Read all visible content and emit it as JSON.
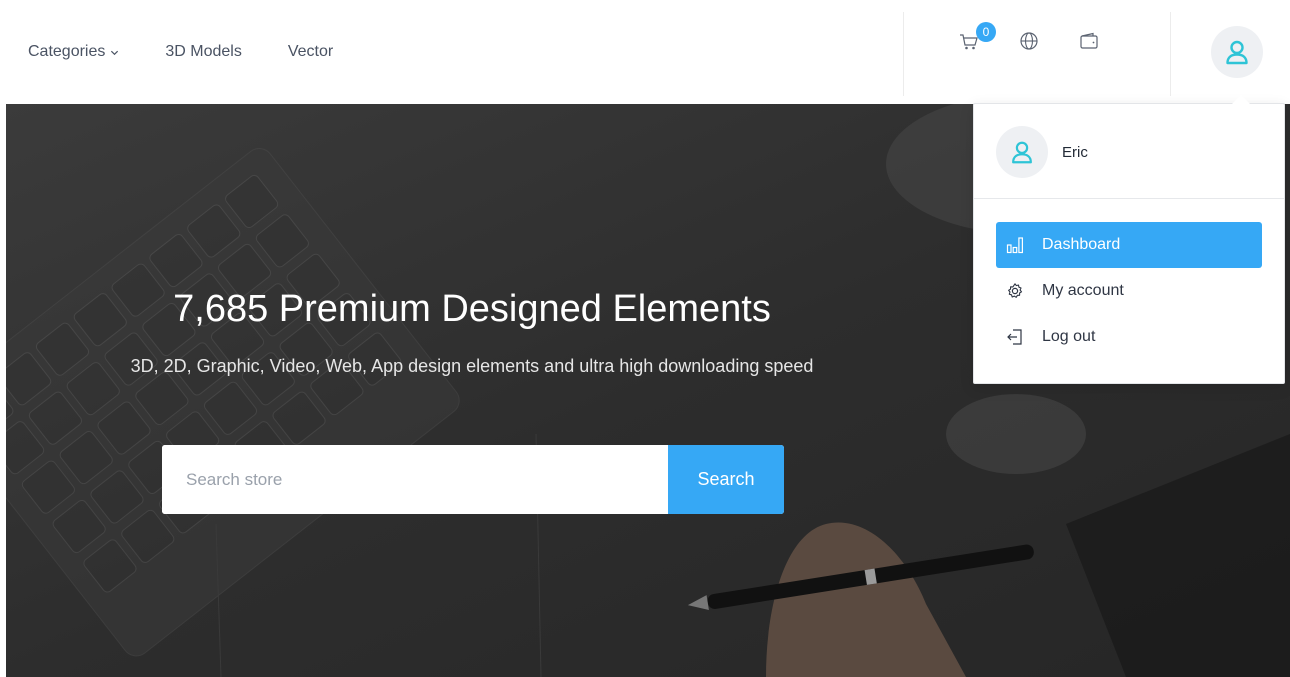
{
  "nav": {
    "categories_label": "Categories",
    "models_label": "3D Models",
    "vector_label": "Vector"
  },
  "header": {
    "cart_count": "0",
    "icons": [
      "cart-icon",
      "globe-icon",
      "wallet-icon",
      "user-icon"
    ]
  },
  "hero": {
    "title": "7,685 Premium Designed Elements",
    "subtitle": "3D, 2D, Graphic, Video, Web, App design elements and ultra high downloading speed"
  },
  "search": {
    "placeholder": "Search store",
    "button_label": "Search"
  },
  "dropdown": {
    "user_name": "Eric",
    "items": [
      {
        "label": "Dashboard",
        "icon": "bar-chart-icon",
        "active": true
      },
      {
        "label": "My account",
        "icon": "gear-icon",
        "active": false
      },
      {
        "label": "Log out",
        "icon": "logout-icon",
        "active": false
      }
    ]
  },
  "colors": {
    "accent": "#36a8f5",
    "avatar_icon": "#2ec4d6",
    "text": "#4a5363"
  }
}
